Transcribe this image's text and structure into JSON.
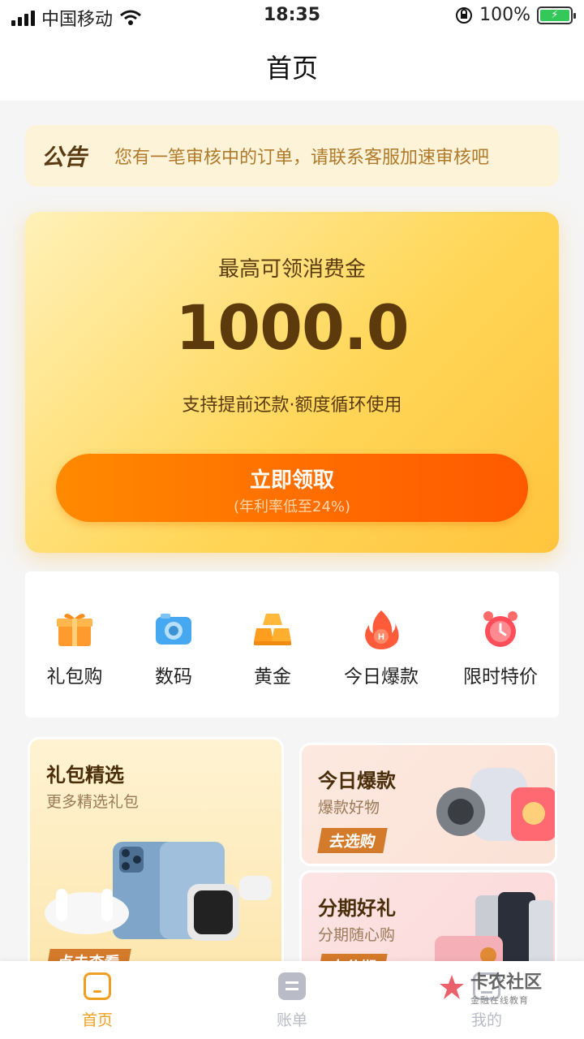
{
  "status_bar": {
    "carrier": "中国移动",
    "time": "18:35",
    "battery_percent": "100%"
  },
  "nav": {
    "title": "首页"
  },
  "notice": {
    "tag": "公告",
    "text": "您有一笔审核中的订单，请联系客服加速审核吧"
  },
  "hero": {
    "subtitle": "最高可领消费金",
    "amount": "1000.0",
    "desc": "支持提前还款·额度循环使用",
    "cta_label": "立即领取",
    "cta_note": "(年利率低至24%)"
  },
  "categories": [
    {
      "label": "礼包购",
      "icon": "gift-icon"
    },
    {
      "label": "数码",
      "icon": "camera-icon"
    },
    {
      "label": "黄金",
      "icon": "gold-bars-icon"
    },
    {
      "label": "今日爆款",
      "icon": "fire-icon"
    },
    {
      "label": "限时特价",
      "icon": "alarm-clock-icon"
    }
  ],
  "cards": {
    "gift_select": {
      "title": "礼包精选",
      "subtitle": "更多精选礼包",
      "button": "点击查看"
    },
    "hot_today": {
      "title": "今日爆款",
      "subtitle": "爆款好物",
      "button": "去选购"
    },
    "installment": {
      "title": "分期好礼",
      "subtitle": "分期随心购",
      "button": "去分期"
    }
  },
  "tabs": [
    {
      "label": "首页",
      "icon": "home-icon",
      "active": true
    },
    {
      "label": "账单",
      "icon": "bill-icon",
      "active": false
    },
    {
      "label": "我的",
      "icon": "profile-icon",
      "active": false
    }
  ],
  "watermark": {
    "title": "卡农社区",
    "subtitle": "金融在线教育"
  },
  "colors": {
    "accent": "#ff7a00",
    "hero_gold": "#ffd75a",
    "tab_active": "#f0a020",
    "tab_inactive": "#b9bcc6"
  }
}
